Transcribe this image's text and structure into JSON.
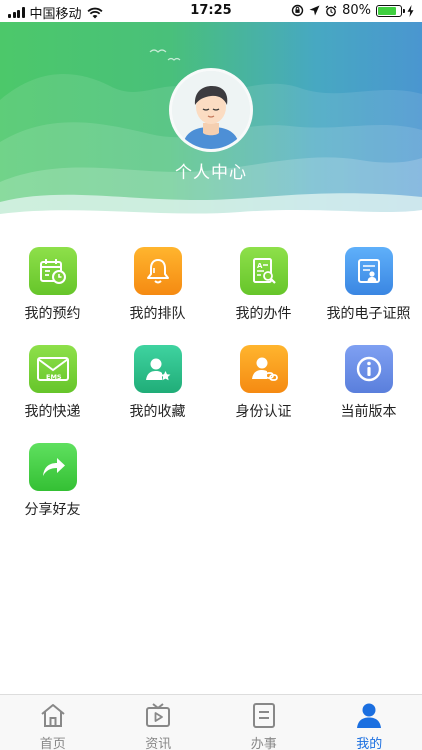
{
  "status_bar": {
    "carrier": "中国移动",
    "time": "17:25",
    "battery": "80%",
    "battery_level": 0.8
  },
  "header": {
    "title": "个人中心"
  },
  "grid": [
    {
      "label": "我的预约",
      "icon": "calendar-icon",
      "color": "#7ed23b"
    },
    {
      "label": "我的排队",
      "icon": "bell-icon",
      "color": "#f7a01c"
    },
    {
      "label": "我的办件",
      "icon": "document-search-icon",
      "color": "#7ed23b"
    },
    {
      "label": "我的电子证照",
      "icon": "id-card-icon",
      "color": "#4a9ff0"
    },
    {
      "label": "我的快递",
      "icon": "envelope-icon",
      "color": "#7ed23b",
      "badge": "EMS"
    },
    {
      "label": "我的收藏",
      "icon": "user-star-icon",
      "color": "#2fc28e"
    },
    {
      "label": "身份认证",
      "icon": "user-link-icon",
      "color": "#f7a01c"
    },
    {
      "label": "当前版本",
      "icon": "info-icon",
      "color": "#6a8ce8"
    },
    {
      "label": "分享好友",
      "icon": "share-icon",
      "color": "#4cd04c"
    }
  ],
  "tabs": [
    {
      "label": "首页",
      "icon": "home-icon"
    },
    {
      "label": "资讯",
      "icon": "tv-icon"
    },
    {
      "label": "办事",
      "icon": "list-icon"
    },
    {
      "label": "我的",
      "icon": "person-icon",
      "active": true
    }
  ]
}
